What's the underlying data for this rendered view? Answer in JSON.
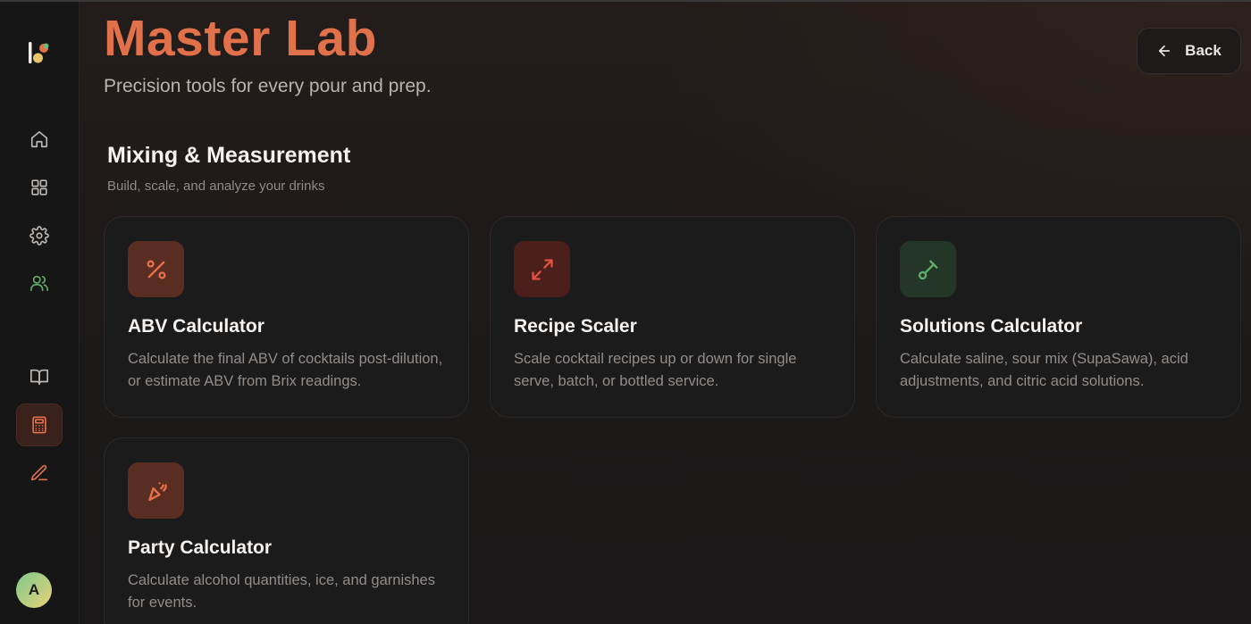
{
  "header": {
    "title": "Master Lab",
    "subtitle": "Precision tools for every pour and prep.",
    "back_label": "Back"
  },
  "sidebar": {
    "items": [
      {
        "icon": "home-icon"
      },
      {
        "icon": "grid-icon"
      },
      {
        "icon": "gear-icon"
      },
      {
        "icon": "users-icon"
      },
      {
        "icon": "book-icon"
      },
      {
        "icon": "calculator-icon",
        "active": true
      },
      {
        "icon": "pencil-icon"
      }
    ],
    "avatar_initial": "A"
  },
  "section": {
    "title": "Mixing & Measurement",
    "subtitle": "Build, scale, and analyze your drinks"
  },
  "cards": [
    {
      "icon": "percent-icon",
      "title": "ABV Calculator",
      "description": "Calculate the final ABV of cocktails post-dilution, or estimate ABV from Brix readings."
    },
    {
      "icon": "expand-arrows-icon",
      "title": "Recipe Scaler",
      "description": "Scale cocktail recipes up or down for single serve, batch, or bottled service."
    },
    {
      "icon": "pipette-icon",
      "title": "Solutions Calculator",
      "description": "Calculate saline, sour mix (SupaSawa), acid adjustments, and citric acid solutions."
    },
    {
      "icon": "party-popper-icon",
      "title": "Party Calculator",
      "description": "Calculate alcohol quantities, ice, and garnishes for events."
    }
  ],
  "colors": {
    "accent": "#e0714b",
    "green_accent": "#5fae6a",
    "background": "#1a1717"
  }
}
